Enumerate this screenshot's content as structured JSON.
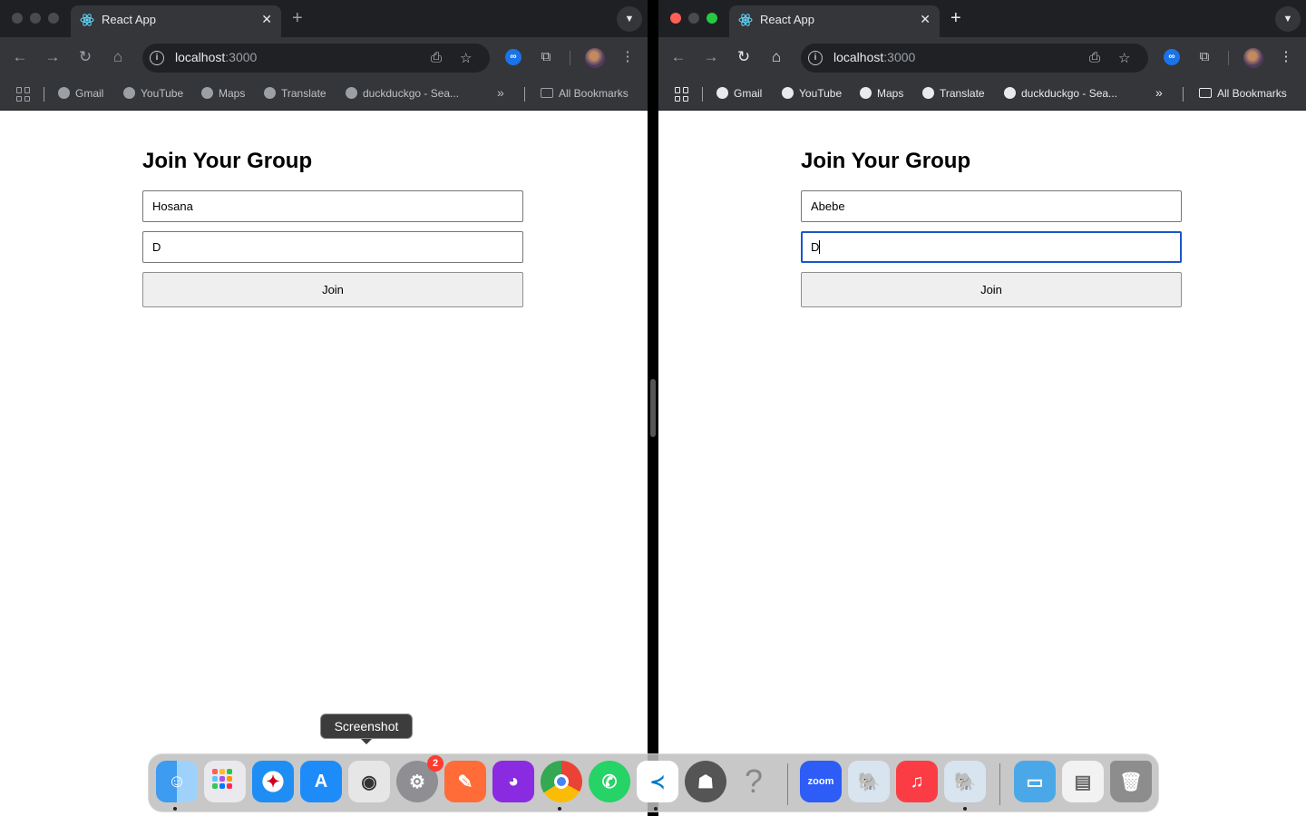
{
  "windows": [
    {
      "tab_title": "React App",
      "tab_close": "✕",
      "new_tab": "+",
      "url_host": "localhost",
      "url_port": ":3000",
      "bookmarks": [
        "Gmail",
        "YouTube",
        "Maps",
        "Translate",
        "duckduckgo - Sea..."
      ],
      "more_bookmarks": "»",
      "all_bookmarks": "All Bookmarks",
      "page": {
        "heading": "Join Your Group",
        "name_value": "Hosana",
        "group_value": "D",
        "join_label": "Join"
      }
    },
    {
      "tab_title": "React App",
      "tab_close": "✕",
      "new_tab": "+",
      "url_host": "localhost",
      "url_port": ":3000",
      "bookmarks": [
        "Gmail",
        "YouTube",
        "Maps",
        "Translate",
        "duckduckgo - Sea..."
      ],
      "more_bookmarks": "»",
      "all_bookmarks": "All Bookmarks",
      "page": {
        "heading": "Join Your Group",
        "name_value": "Abebe",
        "group_value": "D",
        "join_label": "Join"
      }
    }
  ],
  "dock": {
    "tooltip": "Screenshot",
    "settings_badge": "2",
    "zoom_label": "zoom",
    "apps": [
      "Finder",
      "Launchpad",
      "Safari",
      "App Store",
      "Screenshot",
      "System Settings",
      "Postman",
      "GitHub Desktop",
      "Chrome",
      "WhatsApp",
      "VS Code",
      "TablePlus",
      "Help",
      "Zoom",
      "pgAdmin",
      "Music",
      "pgAdmin",
      "Downloads",
      "Documents",
      "Trash"
    ]
  },
  "colors": {
    "focus_ring": "#1a56c9",
    "chrome_dark": "#35363a",
    "tabstrip": "#1f2023"
  }
}
